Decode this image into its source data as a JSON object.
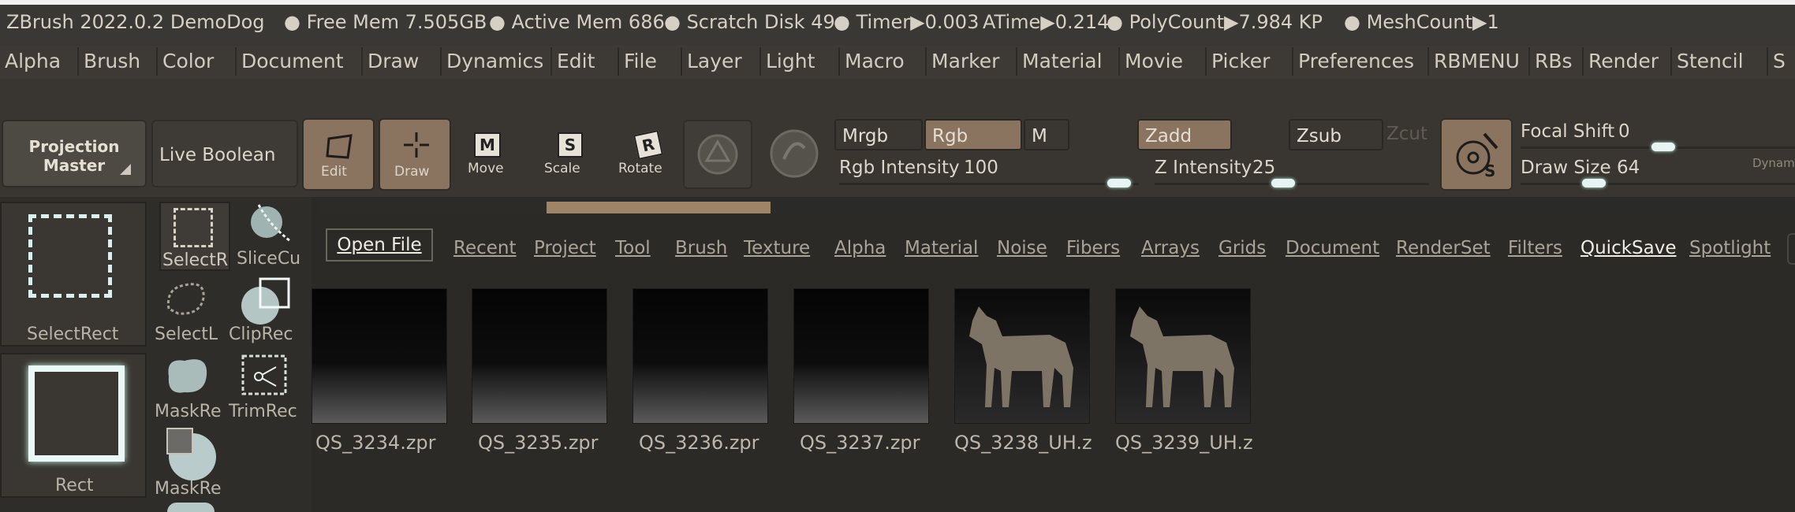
{
  "status_bar": {
    "app": "ZBrush 2022.0.2 DemoDog",
    "free_mem": "● Free Mem 7.505GB",
    "active_mem": "● Active Mem 686",
    "scratch": "● Scratch Disk 49",
    "timer": "● Timer▶0.003",
    "atime": "ATime▶0.214",
    "polycount": "● PolyCount▶7.984 KP",
    "meshcount": "● MeshCount▶1"
  },
  "menu": [
    "Alpha",
    "Brush",
    "Color",
    "Document",
    "Draw",
    "Dynamics",
    "Edit",
    "File",
    "Layer",
    "Light",
    "Macro",
    "Marker",
    "Material",
    "Movie",
    "Picker",
    "Preferences",
    "RBMENU",
    "RBs",
    "Render",
    "Stencil",
    "S"
  ],
  "toolbar": {
    "projection_master": [
      "Projection",
      "Master"
    ],
    "live_boolean": "Live Boolean",
    "edit": "Edit",
    "draw": "Draw",
    "move": "Move",
    "scale": "Scale",
    "rotate": "Rotate",
    "mrgb": "Mrgb",
    "rgb": "Rgb",
    "m": "M",
    "rgb_intensity_label": "Rgb Intensity",
    "rgb_intensity_value": "100",
    "zadd": "Zadd",
    "zsub": "Zsub",
    "zcut": "Zcut",
    "z_intensity_label": "Z Intensity",
    "z_intensity_value": "25",
    "focal_shift_label": "Focal Shift",
    "focal_shift_value": "0",
    "draw_size_label": "Draw Size",
    "draw_size_value": "64",
    "dynamic": "Dynam"
  },
  "tools": {
    "select_rect_big": "SelectRect",
    "rect_big": "Rect",
    "small": [
      "SelectR",
      "SliceCu",
      "SelectL",
      "ClipRec",
      "MaskRe",
      "TrimRec",
      "MaskRe"
    ]
  },
  "browser": {
    "open_file": "Open File",
    "tabs": [
      "Recent",
      "Project",
      "Tool",
      "Brush",
      "Texture",
      "Alpha",
      "Material",
      "Noise",
      "Fibers",
      "Arrays",
      "Grids",
      "Document",
      "RenderSet",
      "Filters",
      "QuickSave",
      "Spotlight"
    ],
    "active_tab": "QuickSave",
    "files": [
      "QS_3234.zpr",
      "QS_3235.zpr",
      "QS_3236.zpr",
      "QS_3237.zpr",
      "QS_3238_UH.z",
      "QS_3239_UH.z"
    ]
  },
  "colors": {
    "accent_tan": "#8a7460",
    "progress_fill": "#9e8567",
    "knob": "#e8f4f2"
  }
}
